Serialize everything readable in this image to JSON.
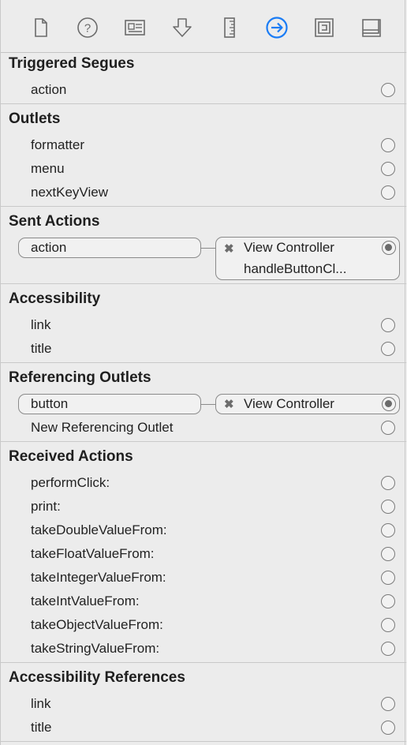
{
  "toolbar": {
    "icons": [
      "file-inspector-icon",
      "quick-help-icon",
      "identity-inspector-icon",
      "attributes-inspector-icon",
      "size-inspector-icon",
      "connections-inspector-icon",
      "bindings-inspector-icon",
      "view-effects-inspector-icon"
    ],
    "active_index": 5,
    "active_color": "#1a7cf5"
  },
  "triggered_segues": {
    "title": "Triggered Segues",
    "rows": [
      "action"
    ]
  },
  "outlets": {
    "title": "Outlets",
    "rows": [
      "formatter",
      "menu",
      "nextKeyView"
    ]
  },
  "sent_actions": {
    "title": "Sent Actions",
    "source": "action",
    "target_name": "View Controller",
    "target_method": "handleButtonCl..."
  },
  "accessibility": {
    "title": "Accessibility",
    "rows": [
      "link",
      "title"
    ]
  },
  "referencing_outlets": {
    "title": "Referencing Outlets",
    "source": "button",
    "target_name": "View Controller",
    "new_label": "New Referencing Outlet"
  },
  "received_actions": {
    "title": "Received Actions",
    "rows": [
      "performClick:",
      "print:",
      "takeDoubleValueFrom:",
      "takeFloatValueFrom:",
      "takeIntegerValueFrom:",
      "takeIntValueFrom:",
      "takeObjectValueFrom:",
      "takeStringValueFrom:"
    ]
  },
  "accessibility_references": {
    "title": "Accessibility References",
    "rows": [
      "link",
      "title"
    ]
  },
  "remove_mark": "✖"
}
